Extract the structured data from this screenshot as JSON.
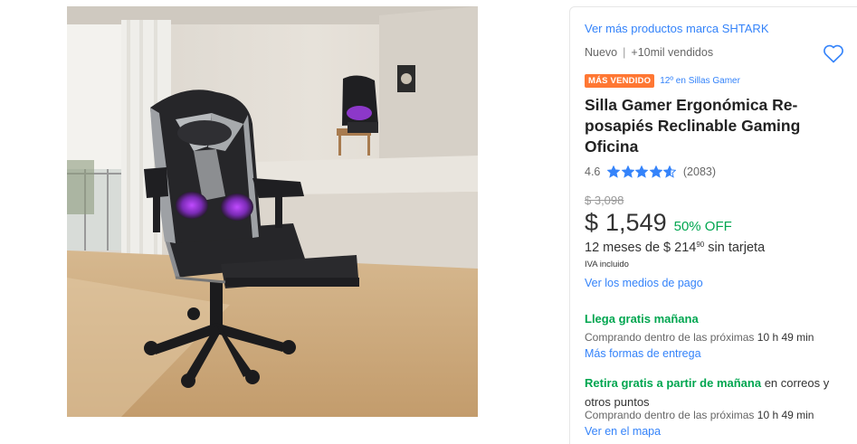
{
  "product": {
    "brand_link": "Ver más productos marca SHTARK",
    "condition": "Nuevo",
    "sold": "+10mil vendidos",
    "badge": "MÁS VENDIDO",
    "ranking": "12º en Sillas Gamer",
    "title": "Silla Gamer Ergonómica Re-posapiés Reclinable Gaming Oficina",
    "rating": "4.6",
    "stars": 4.6,
    "reviews": "(2083)"
  },
  "pricing": {
    "original": "$ 3,098",
    "currency": "$",
    "amount": "1,549",
    "discount": "50% OFF",
    "installments_prefix": "12 meses de $ 214",
    "installments_cents": "90",
    "installments_suffix": " sin tarjeta",
    "tax_note": "IVA incluido",
    "payment_link": "Ver los medios de pago"
  },
  "shipping": {
    "title": "Llega gratis mañana",
    "subtitle_prefix": "Comprando dentro de las próximas ",
    "time": "10 h 49 min",
    "link": "Más formas de entrega"
  },
  "pickup": {
    "title_green": "Retira gratis a partir de mañana",
    "title_rest": " en correos y otros puntos",
    "subtitle_prefix": "Comprando dentro de las próximas ",
    "time": "10 h 49 min",
    "link": "Ver en el mapa"
  },
  "colors": {
    "link": "#3483fa",
    "green": "#00a650",
    "badge": "#ff7733",
    "star": "#3483fa"
  },
  "icons": {
    "favorite": "heart-icon",
    "rating": "star-icon"
  }
}
